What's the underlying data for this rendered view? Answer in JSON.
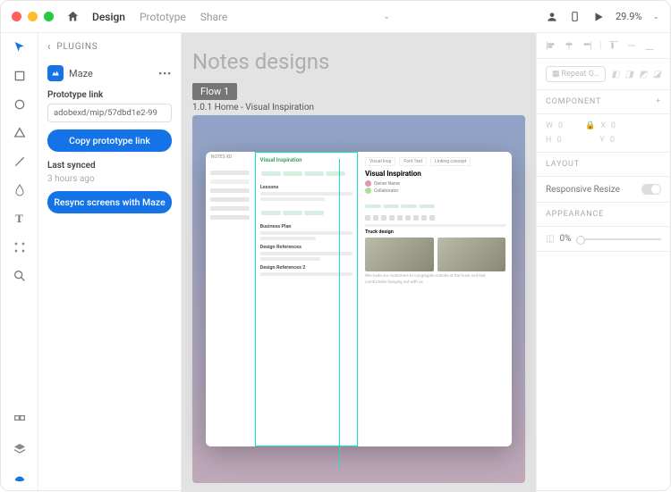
{
  "titlebar": {
    "tabs": [
      "Design",
      "Prototype",
      "Share"
    ],
    "activeTab": 0,
    "zoom": "29.9%"
  },
  "leftpanel": {
    "header": "PLUGINS",
    "plugin": {
      "name": "Maze"
    },
    "protoLabel": "Prototype link",
    "protoLink": "adobexd/mip/57dbd1e2-99",
    "copyBtn": "Copy prototype link",
    "lastSyncedLabel": "Last synced",
    "lastSyncedValue": "3 hours ago",
    "resyncBtn": "Resync screens with Maze"
  },
  "canvas": {
    "title": "Notes designs",
    "flow": "Flow 1",
    "artboardLabel": "1.0.1 Home - Visual Inspiration",
    "preview": {
      "appName": "NOTES XD",
      "midTitle": "Visual Inspiration",
      "midSections": [
        "Lessons",
        "Business Plan",
        "Design References",
        "Design References 2"
      ],
      "rightTabs": [
        "Visual Insp",
        "Font Test",
        "Linking concept"
      ],
      "rightTitle": "Visual Inspiration",
      "rightSubhead": "Truck design"
    }
  },
  "rightpanel": {
    "repeatGrid": "Repeat G…",
    "componentHeader": "COMPONENT",
    "w": "0",
    "x": "0",
    "h": "0",
    "y": "0",
    "layoutHeader": "LAYOUT",
    "responsive": "Responsive Resize",
    "appearanceHeader": "APPEARANCE",
    "opacity": "0%"
  }
}
